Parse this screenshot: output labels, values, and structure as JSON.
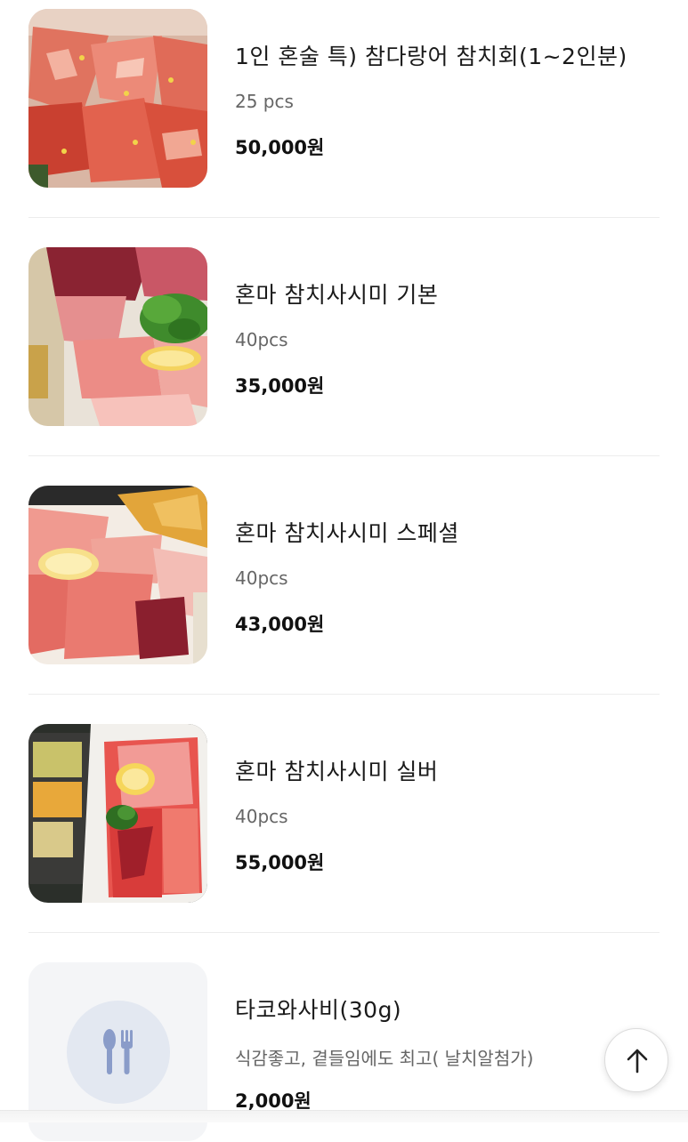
{
  "menu_items": [
    {
      "name": "1인 혼술 특) 참다랑어 참치회(1~2인분)",
      "description": "25 pcs",
      "price": "50,000원",
      "image": "tuna-sashimi-slices-photo"
    },
    {
      "name": "혼마 참치사시미 기본",
      "description": "40pcs",
      "price": "35,000원",
      "image": "tuna-sashimi-platter-parsley-lemon-photo"
    },
    {
      "name": "혼마 참치사시미 스페셜",
      "description": "40pcs",
      "price": "43,000원",
      "image": "tuna-sashimi-box-tempura-photo"
    },
    {
      "name": "혼마 참치사시미 실버",
      "description": "40pcs",
      "price": "55,000원",
      "image": "tuna-sashimi-box-side-dishes-photo"
    },
    {
      "name": "타코와사비(30g)",
      "description": "식감좋고, 곁들임에도 최고( 날치알첨가)",
      "price": "2,000원",
      "image": "utensils-placeholder-icon"
    }
  ],
  "scroll_top_button": {
    "icon": "arrow-up-icon"
  },
  "colors": {
    "divider": "#ececec",
    "placeholder_bg": "#f4f5f7",
    "placeholder_circle": "#e3e8f1",
    "placeholder_icon": "#8a9cc9"
  }
}
